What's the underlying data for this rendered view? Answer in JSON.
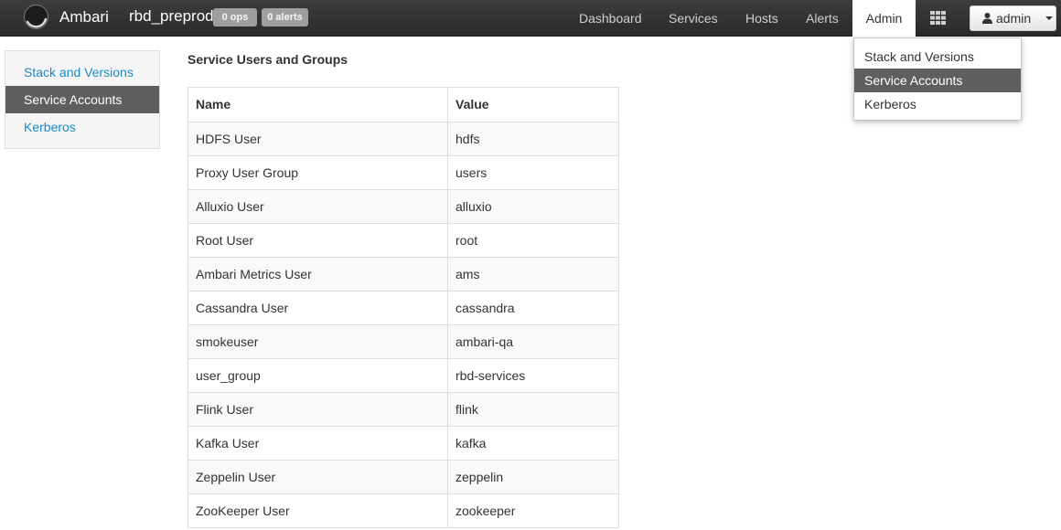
{
  "navbar": {
    "brand": "Ambari",
    "cluster_name": "rbd_preprod",
    "ops_badge": "0 ops",
    "alerts_badge": "0 alerts",
    "links": [
      "Dashboard",
      "Services",
      "Hosts",
      "Alerts",
      "Admin"
    ],
    "active_link": "Admin",
    "user_label": "admin",
    "icons": {
      "logo": "ambari-logo-icon",
      "apps": "apps-grid-icon",
      "user": "user-icon",
      "caret": "caret-down-icon"
    }
  },
  "sidebar": {
    "items": [
      {
        "label": "Stack and Versions"
      },
      {
        "label": "Service Accounts"
      },
      {
        "label": "Kerberos"
      }
    ],
    "active": "Service Accounts"
  },
  "main": {
    "title": "Service Users and Groups",
    "columns": [
      "Name",
      "Value"
    ],
    "rows": [
      [
        "HDFS User",
        "hdfs"
      ],
      [
        "Proxy User Group",
        "users"
      ],
      [
        "Alluxio User",
        "alluxio"
      ],
      [
        "Root User",
        "root"
      ],
      [
        "Ambari Metrics User",
        "ams"
      ],
      [
        "Cassandra User",
        "cassandra"
      ],
      [
        "smokeuser",
        "ambari-qa"
      ],
      [
        "user_group",
        "rbd-services"
      ],
      [
        "Flink User",
        "flink"
      ],
      [
        "Kafka User",
        "kafka"
      ],
      [
        "Zeppelin User",
        "zeppelin"
      ],
      [
        "ZooKeeper User",
        "zookeeper"
      ]
    ]
  },
  "admin_menu": {
    "items": [
      "Stack and Versions",
      "Service Accounts",
      "Kerberos"
    ],
    "highlighted": "Service Accounts"
  },
  "colors": {
    "navbar": "#333333",
    "link": "#1b8bc8",
    "active_item": "#5f5f5f",
    "badge": "#9e9e9e"
  }
}
